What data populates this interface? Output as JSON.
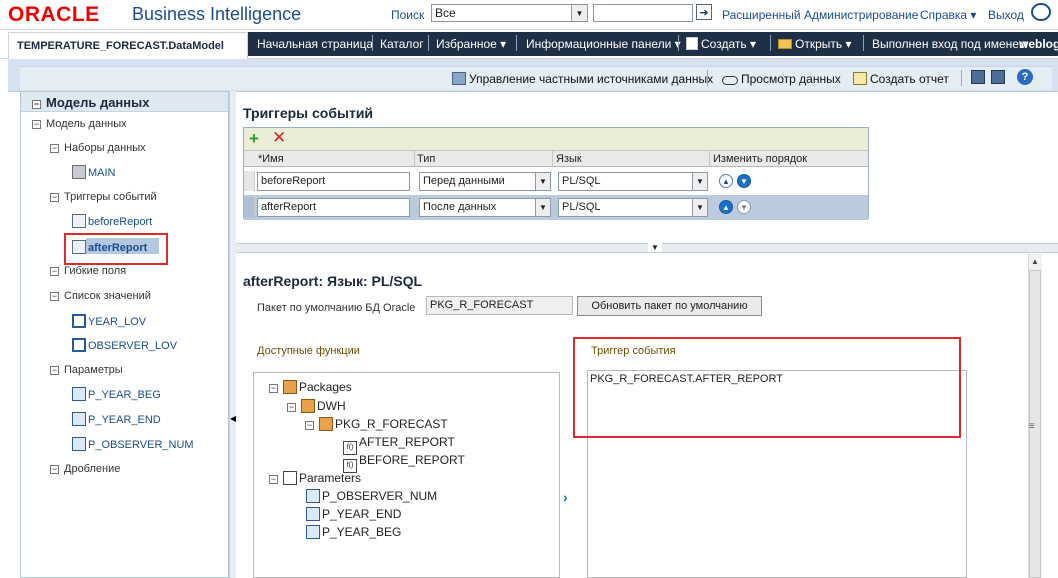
{
  "brand": {
    "logo": "ORACLE",
    "product": "Business Intelligence"
  },
  "search": {
    "label": "Поиск",
    "scope": "Все",
    "value": ""
  },
  "top_links": {
    "advanced": "Расширенный",
    "admin": "Администрирование",
    "help": "Справка ▾",
    "logout": "Выход"
  },
  "document_tab": "TEMPERATURE_FORECAST.DataModel",
  "nav": {
    "home": "Начальная страница",
    "catalog": "Каталог",
    "favorites": "Избранное ▾",
    "dashboards": "Информационные панели ▾",
    "create": "Создать ▾",
    "open": "Открыть ▾",
    "signed_in": "Выполнен вход под именем",
    "user": "weblog"
  },
  "toolbar": {
    "private_sources": "Управление частными источниками данных",
    "view_data": "Просмотр данных",
    "create_report": "Создать отчет"
  },
  "left_panel": {
    "title": "Модель данных",
    "root": "Модель данных",
    "datasets": {
      "label": "Наборы данных",
      "items": [
        "MAIN"
      ]
    },
    "triggers": {
      "label": "Триггеры событий",
      "items": [
        "beforeReport",
        "afterReport"
      ]
    },
    "flexfields": "Гибкие поля",
    "lov": {
      "label": "Список значений",
      "items": [
        "YEAR_LOV",
        "OBSERVER_LOV"
      ]
    },
    "parameters": {
      "label": "Параметры",
      "items": [
        "P_YEAR_BEG",
        "P_YEAR_END",
        "P_OBSERVER_NUM"
      ]
    },
    "bursting": "Дробление"
  },
  "event_triggers": {
    "title": "Триггеры событий",
    "columns": {
      "name": "*Имя",
      "type": "Тип",
      "language": "Язык",
      "order": "Изменить порядок"
    },
    "rows": [
      {
        "name": "beforeReport",
        "type": "Перед данными",
        "language": "PL/SQL"
      },
      {
        "name": "afterReport",
        "type": "После данных",
        "language": "PL/SQL"
      }
    ]
  },
  "detail": {
    "title": "afterReport: Язык: PL/SQL",
    "pkg_label": "Пакет по умолчанию БД Oracle",
    "pkg_value": "PKG_R_FORECAST",
    "refresh_button": "Обновить пакет по умолчанию",
    "available_functions": "Доступные функции",
    "tree": {
      "packages": "Packages",
      "schema": "DWH",
      "package": "PKG_R_FORECAST",
      "functions": [
        "AFTER_REPORT",
        "BEFORE_REPORT"
      ],
      "parameters": "Parameters",
      "params": [
        "P_OBSERVER_NUM",
        "P_YEAR_END",
        "P_YEAR_BEG"
      ]
    },
    "trigger_label": "Триггер события",
    "trigger_value": "PKG_R_FORECAST.AFTER_REPORT"
  }
}
